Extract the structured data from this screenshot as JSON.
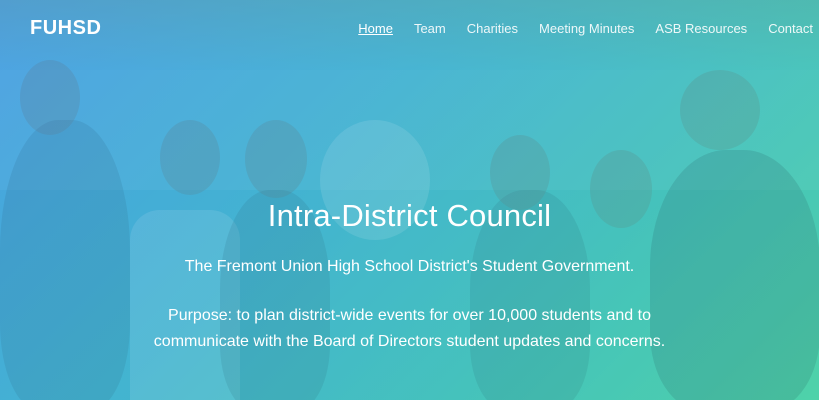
{
  "header": {
    "brand": "FUHSD",
    "nav": [
      {
        "label": "Home",
        "active": true
      },
      {
        "label": "Team"
      },
      {
        "label": "Charities"
      },
      {
        "label": "Meeting Minutes"
      },
      {
        "label": "ASB Resources"
      },
      {
        "label": "Contact"
      }
    ]
  },
  "hero": {
    "title": "Intra-District Council",
    "subtitle": "The Fremont Union High School District's Student Government.",
    "purpose": "Purpose: to plan district-wide events for over 10,000 students and to communicate with the Board of Directors student updates and concerns."
  },
  "colors": {
    "gradient_start": "#4aa7e0",
    "gradient_end": "#56d2a8",
    "text": "#ffffff"
  }
}
